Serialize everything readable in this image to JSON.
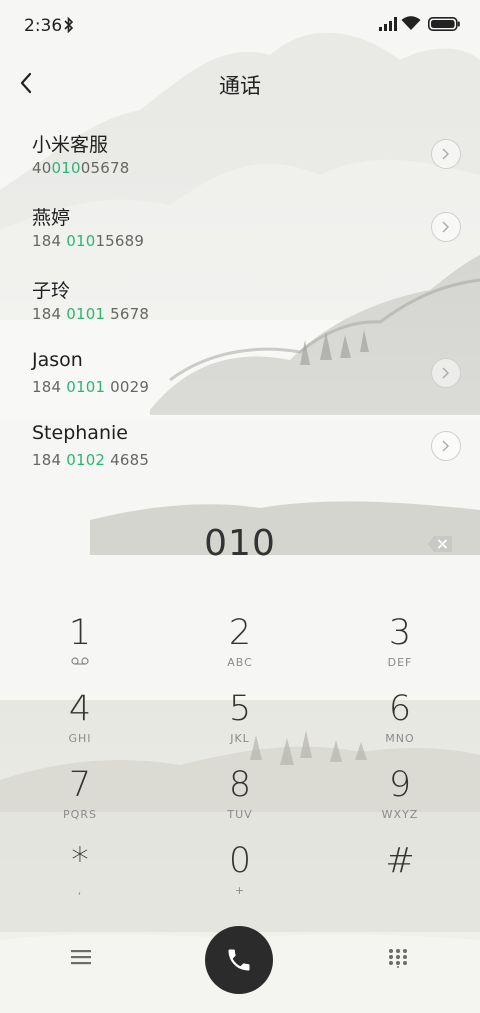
{
  "status_bar": {
    "time": "2:36"
  },
  "header": {
    "title": "通话"
  },
  "contacts": [
    {
      "name": "小米客服",
      "number_pre": "40",
      "number_match": "010",
      "number_post": "05678"
    },
    {
      "name": "燕婷",
      "number_pre": "184 ",
      "number_match": "010",
      "number_post": "15689"
    },
    {
      "name": "子玲",
      "number_pre": "184 ",
      "number_match": "0101",
      "number_post": " 5678"
    },
    {
      "name": "Jason",
      "number_pre": "184 ",
      "number_match": "0101",
      "number_post": " 0029"
    },
    {
      "name": "Stephanie",
      "number_pre": "184 ",
      "number_match": "0102",
      "number_post": " 4685"
    }
  ],
  "dialer": {
    "input": "010"
  },
  "keys": [
    {
      "digit": "1",
      "sub": ""
    },
    {
      "digit": "2",
      "sub": "ABC"
    },
    {
      "digit": "3",
      "sub": "DEF"
    },
    {
      "digit": "4",
      "sub": "GHI"
    },
    {
      "digit": "5",
      "sub": "JKL"
    },
    {
      "digit": "6",
      "sub": "MNO"
    },
    {
      "digit": "7",
      "sub": "PQRS"
    },
    {
      "digit": "8",
      "sub": "TUV"
    },
    {
      "digit": "9",
      "sub": "WXYZ"
    },
    {
      "digit": "*",
      "sub": ","
    },
    {
      "digit": "0",
      "sub": "+"
    },
    {
      "digit": "#",
      "sub": ""
    }
  ],
  "colors": {
    "match_highlight": "#2bb673",
    "call_button": "#2b2b2b"
  }
}
